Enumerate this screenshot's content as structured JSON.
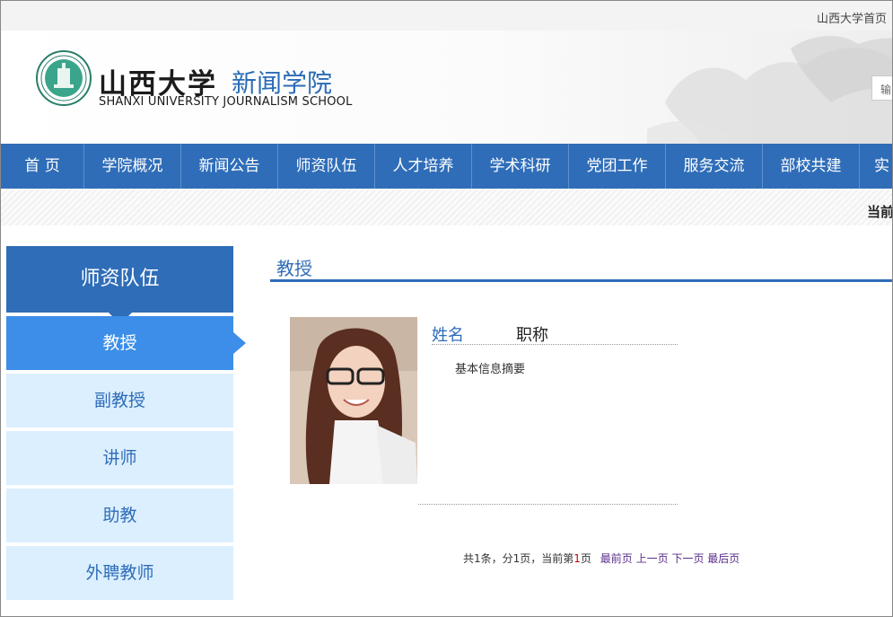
{
  "topbar": {
    "home_link": "山西大学首页"
  },
  "header": {
    "logo_cn": "山西大学",
    "school_name": "新闻学院",
    "logo_en": "SHANXI UNIVERSITY JOURNALISM SCHOOL",
    "search_placeholder": "输"
  },
  "nav": {
    "items": [
      {
        "label": "首  页"
      },
      {
        "label": "学院概况"
      },
      {
        "label": "新闻公告"
      },
      {
        "label": "师资队伍"
      },
      {
        "label": "人才培养"
      },
      {
        "label": "学术科研"
      },
      {
        "label": "党团工作"
      },
      {
        "label": "服务交流"
      },
      {
        "label": "部校共建"
      },
      {
        "label": "实"
      }
    ]
  },
  "breadcrumb": {
    "text": "当前"
  },
  "sidebar": {
    "title": "师资队伍",
    "items": [
      {
        "label": "教授",
        "active": true
      },
      {
        "label": "副教授"
      },
      {
        "label": "讲师"
      },
      {
        "label": "助教"
      },
      {
        "label": "外聘教师"
      }
    ]
  },
  "main": {
    "section_title": "教授",
    "profile": {
      "name_label": "姓名",
      "title_label": "职称",
      "summary": "基本信息摘要"
    },
    "pager": {
      "summary_prefix": "共1条，分1页，当前第",
      "current": "1",
      "summary_suffix": "页",
      "first": "最前页",
      "prev": "上一页",
      "next": "下一页",
      "last": "最后页"
    }
  },
  "colors": {
    "primary": "#2f6db8",
    "active": "#3c8ee8",
    "side_bg": "#dcefff"
  }
}
